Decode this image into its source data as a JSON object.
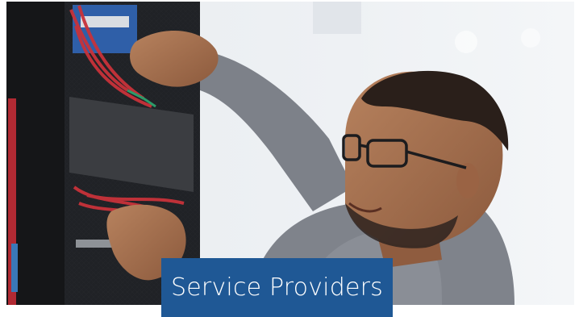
{
  "card": {
    "caption": "Service Providers"
  },
  "photo": {
    "subject": "technician-patching-server-rack"
  },
  "colors": {
    "caption_bg": "#1f5895",
    "caption_text": "#ffffff",
    "rack_dark": "#1a1b1e",
    "cable_red": "#c8323a",
    "shirt_gray": "#7d8189"
  }
}
